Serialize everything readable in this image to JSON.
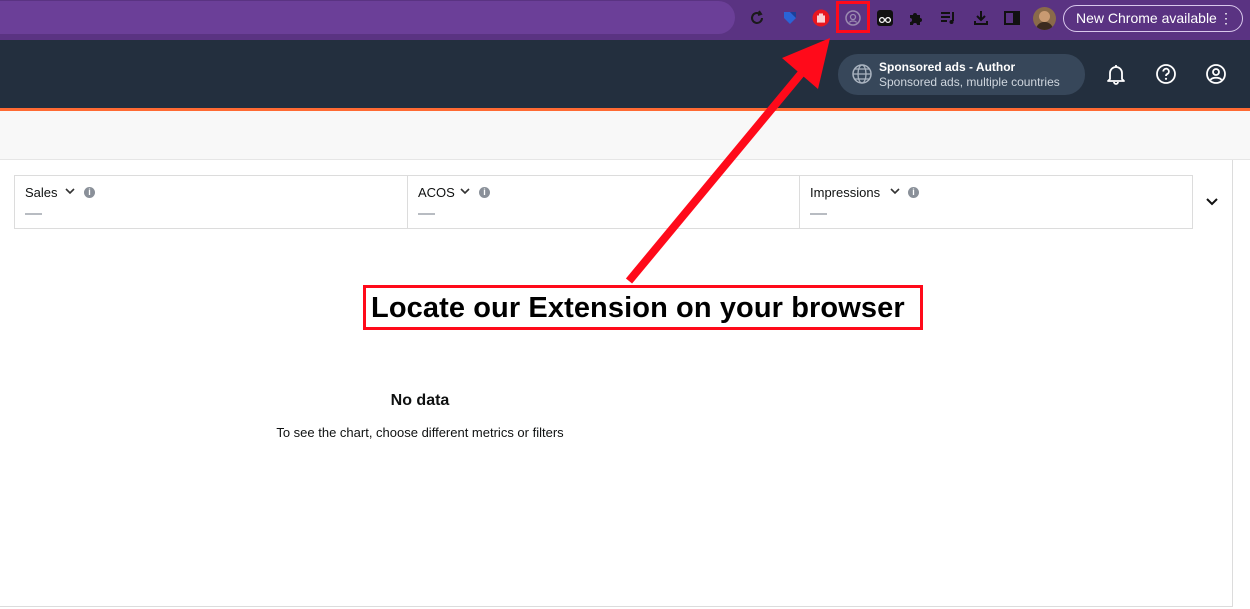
{
  "browser": {
    "new_chrome_label": "New Chrome available",
    "menu_glyph": "⋮",
    "toolbar_icons": [
      "sync-icon",
      "bookmark-extension-icon",
      "hand-stop-extension-icon",
      "highlighted-extension-icon",
      "glasses-extension-icon",
      "puzzle-extensions-icon",
      "reading-list-icon",
      "download-icon",
      "side-panel-icon",
      "profile-avatar"
    ]
  },
  "header": {
    "account_title": "Sponsored ads - Author",
    "account_subtitle": "Sponsored ads, multiple countries",
    "icons": [
      "globe-icon",
      "bell-icon",
      "help-icon",
      "account-icon"
    ]
  },
  "metrics": [
    {
      "label": "Sales",
      "value": "—"
    },
    {
      "label": "ACOS",
      "value": "—"
    },
    {
      "label": "Impressions",
      "value": "—"
    }
  ],
  "empty_state": {
    "title": "No data",
    "message": "To see the chart, choose different metrics or filters"
  },
  "annotation": {
    "text": "Locate our Extension on your browser",
    "color": "#ff0a1a"
  },
  "colors": {
    "chrome_toolbar": "#5a3382",
    "amazon_header": "#232f3e",
    "accent_orange": "#ff6a33"
  }
}
